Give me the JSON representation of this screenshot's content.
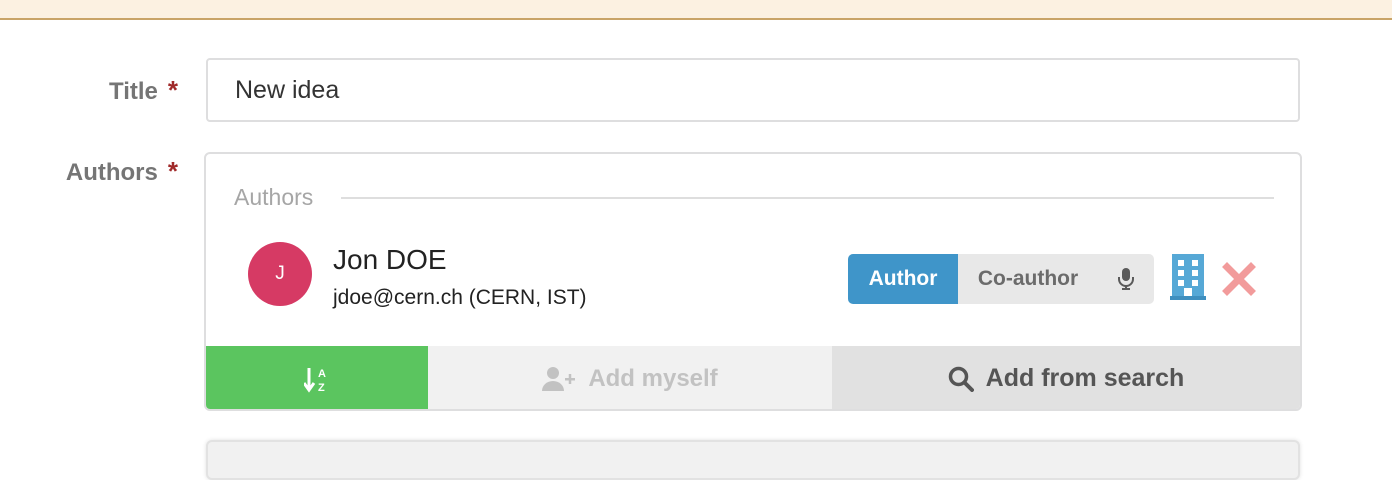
{
  "form": {
    "title_label": "Title",
    "authors_label": "Authors",
    "required_marker": "*",
    "title_value": "New idea"
  },
  "authors_section": {
    "header": "Authors",
    "author": {
      "initial": "J",
      "name": "Jon DOE",
      "email_affiliation": "jdoe@cern.ch (CERN, IST)",
      "avatar_color": "#d63a64"
    },
    "roles": {
      "author_label": "Author",
      "coauthor_label": "Co-author",
      "selected": "Author",
      "speaker_icon": "microphone-icon"
    },
    "icons": {
      "affiliation": "building-icon",
      "remove": "close-icon"
    }
  },
  "actions": {
    "sort_icon": "sort-alpha-icon",
    "add_myself_label": "Add myself",
    "add_from_search_label": "Add from search"
  },
  "colors": {
    "accent_blue": "#3f95c9",
    "success_green": "#5bc55f",
    "danger_red": "#f29b9b",
    "required_red": "#a02a2a"
  }
}
